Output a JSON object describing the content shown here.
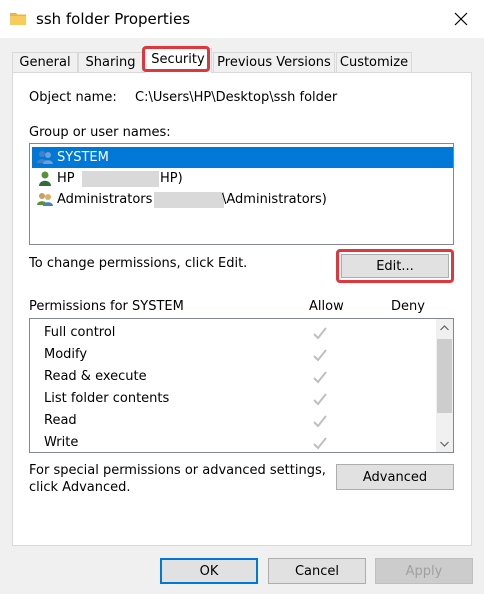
{
  "window": {
    "title": "ssh folder Properties",
    "folder_icon": "folder-icon",
    "close_icon": "close-icon"
  },
  "tabs": [
    {
      "label": "General"
    },
    {
      "label": "Sharing"
    },
    {
      "label": "Security",
      "active": true
    },
    {
      "label": "Previous Versions"
    },
    {
      "label": "Customize"
    }
  ],
  "security": {
    "object_name_label": "Object name:",
    "object_name_value": "C:\\Users\\HP\\Desktop\\ssh folder",
    "group_label": "Group or user names:",
    "users": [
      {
        "prefix": "SYSTEM",
        "suffix": "",
        "icon": "users-group-icon",
        "selected": true
      },
      {
        "prefix": "HP",
        "suffix": "HP)",
        "icon": "user-icon",
        "selected": false
      },
      {
        "prefix": "Administrators (",
        "suffix": "\\Administrators)",
        "icon": "users-group-icon",
        "selected": false
      }
    ],
    "change_text": "To change permissions, click Edit.",
    "edit_button": "Edit...",
    "permissions_label": "Permissions for SYSTEM",
    "allow_header": "Allow",
    "deny_header": "Deny",
    "permissions": [
      {
        "name": "Full control",
        "allow": true,
        "deny": false
      },
      {
        "name": "Modify",
        "allow": true,
        "deny": false
      },
      {
        "name": "Read & execute",
        "allow": true,
        "deny": false
      },
      {
        "name": "List folder contents",
        "allow": true,
        "deny": false
      },
      {
        "name": "Read",
        "allow": true,
        "deny": false
      },
      {
        "name": "Write",
        "allow": true,
        "deny": false
      }
    ],
    "special_text_1": "For special permissions or advanced settings,",
    "special_text_2": "click Advanced.",
    "advanced_button": "Advanced"
  },
  "footer": {
    "ok": "OK",
    "cancel": "Cancel",
    "apply": "Apply"
  },
  "colors": {
    "selection": "#0078d7",
    "highlight": "#e0373d",
    "check_disabled": "#bfbfbf"
  }
}
